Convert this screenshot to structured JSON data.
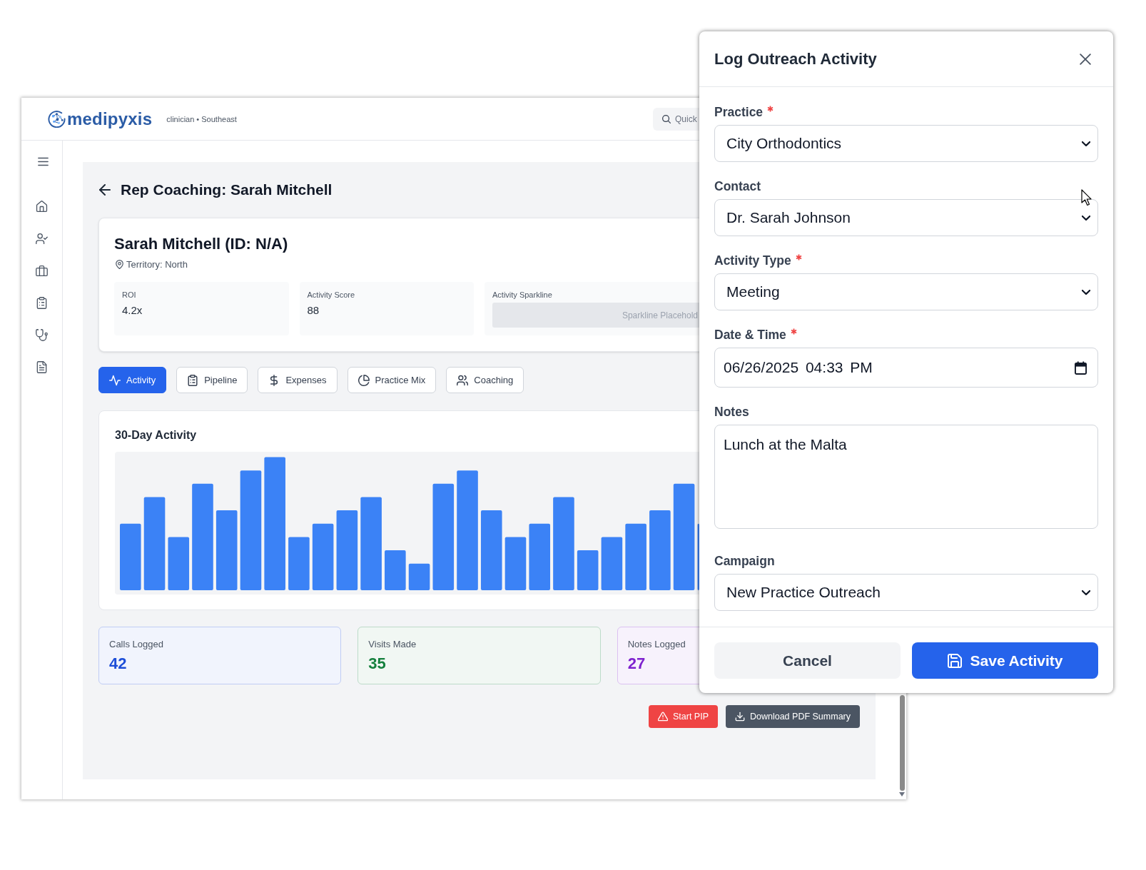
{
  "app": {
    "logo": "medipyxis",
    "context": "clinician • Southeast",
    "search": {
      "placeholder": "Quick"
    }
  },
  "page": {
    "title": "Rep Coaching: Sarah Mitchell"
  },
  "profile": {
    "name": "Sarah Mitchell (ID: N/A)",
    "territory": "Territory: North",
    "metrics": [
      {
        "kind": "value",
        "label": "ROI",
        "value": "4.2x"
      },
      {
        "kind": "value",
        "label": "Activity Score",
        "value": "88"
      },
      {
        "kind": "sparkline",
        "label": "Activity Sparkline",
        "text": "Sparkline Placehold"
      }
    ]
  },
  "tabs": [
    {
      "label": "Activity",
      "selected": true
    },
    {
      "label": "Pipeline",
      "selected": false
    },
    {
      "label": "Expenses",
      "selected": false
    },
    {
      "label": "Practice Mix",
      "selected": false
    },
    {
      "label": "Coaching",
      "selected": false
    }
  ],
  "activity_chart": {
    "title": "30-Day Activity"
  },
  "stats": [
    {
      "label": "Calls Logged",
      "value": "42",
      "color": "#1d4ed8"
    },
    {
      "label": "Visits Made",
      "value": "35",
      "color": "#15803d"
    },
    {
      "label": "Notes Logged",
      "value": "27",
      "color": "#7e22ce"
    }
  ],
  "actions": [
    {
      "kind": "danger",
      "label": "Start PIP"
    },
    {
      "kind": "secondary",
      "label": "Download PDF Summary"
    }
  ],
  "dialog": {
    "title": "Log Outreach Activity",
    "fields": [
      {
        "kind": "select",
        "label": "Practice",
        "required": true,
        "value": "City Orthodontics"
      },
      {
        "kind": "select",
        "label": "Contact",
        "required": false,
        "value": "Dr. Sarah Johnson"
      },
      {
        "kind": "select",
        "label": "Activity Type",
        "required": true,
        "value": "Meeting"
      },
      {
        "kind": "datetime",
        "label": "Date & Time",
        "required": true,
        "value": "06/26/2025 04:33 PM"
      },
      {
        "kind": "textarea",
        "label": "Notes",
        "required": false,
        "value": "Lunch at the Malta"
      },
      {
        "kind": "select",
        "label": "Campaign",
        "required": false,
        "value": "New Practice Outreach"
      }
    ],
    "buttons": [
      {
        "kind": "cancel",
        "label": "Cancel"
      },
      {
        "kind": "primary",
        "label": "Save Activity"
      }
    ]
  }
}
